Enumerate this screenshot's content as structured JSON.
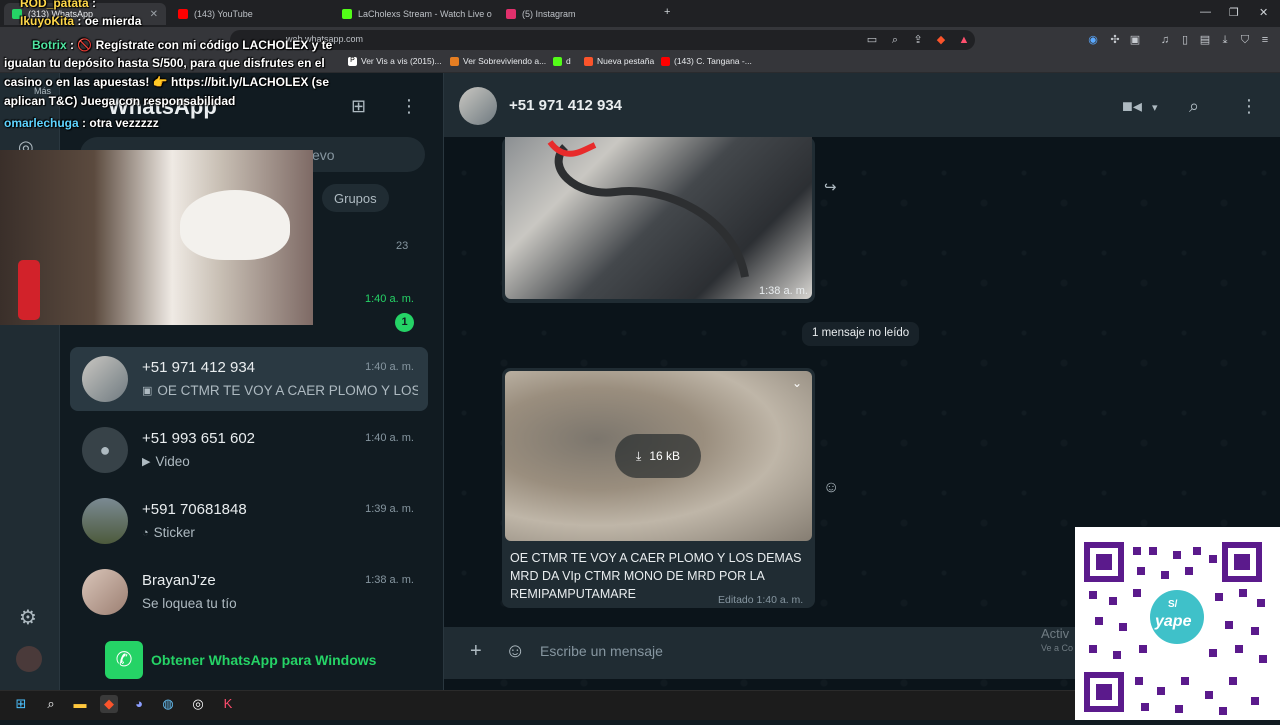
{
  "browser": {
    "tabs": [
      {
        "label": "(313) WhatsApp",
        "active": true,
        "color": "#25d366"
      },
      {
        "label": "(143) YouTube",
        "active": false,
        "color": "#ff0000"
      },
      {
        "label": "LaCholexs Stream - Watch Live o",
        "active": false,
        "color": "#53fc18"
      },
      {
        "label": "(5) Instagram",
        "active": false,
        "color": "#e1306c"
      }
    ],
    "url": "web.whatsapp.com",
    "bookmarks": [
      {
        "label": "Ver Vis a vis (2015)...",
        "icon": "P"
      },
      {
        "label": "Ver Sobreviviendo a...",
        "icon": "N"
      },
      {
        "label": "d",
        "icon": "K"
      },
      {
        "label": "Nueva pestaña",
        "icon": "B"
      },
      {
        "label": "(143) C. Tangana -...",
        "icon": "Y"
      }
    ]
  },
  "whatsapp": {
    "title": "WhatsApp",
    "search_placeholder": "evo",
    "filter_chip": "Groups",
    "filter_chip_text": "Grupos",
    "hidden_row_count": "23",
    "hidden_row_time": "1:40 a. m.",
    "hidden_row_badge": "1",
    "chats": [
      {
        "name": "+51 971 412 934",
        "time": "1:40 a. m.",
        "preview": "OE CTMR TE VOY A CAER PLOMO Y LOS ...",
        "preview_icon": "image-icon",
        "selected": true
      },
      {
        "name": "+51 993 651 602",
        "time": "1:40 a. m.",
        "preview": "Video",
        "preview_icon": "video-icon",
        "selected": false
      },
      {
        "name": "+591 70681848",
        "time": "1:39 a. m.",
        "preview": "Sticker",
        "preview_icon": "sticker-icon",
        "selected": false
      },
      {
        "name": "BrayanJ'ze",
        "time": "1:38 a. m.",
        "preview": "Se loquea tu tío",
        "preview_icon": "",
        "selected": false
      }
    ],
    "get_windows": "Obtener WhatsApp para Windows"
  },
  "conversation": {
    "contact": "+51 971 412 934",
    "image_time": "1:38 a. m.",
    "unread_label": "1 mensaje no leído",
    "download_size": "16 kB",
    "message_text": "OE CTMR TE VOY A CAER PLOMO Y LOS DEMAS MRD DA VIp CTMR MONO DE MRD POR LA REMIPAMPUTAMARE",
    "edited_label": "Editado 1:40 a. m.",
    "composer_placeholder": "Escribe un mensaje",
    "activate_windows": "Activ",
    "activate_windows2": "Ve a Co"
  },
  "overlay": {
    "chat": [
      {
        "user": "ROD_patata",
        "text": ":"
      },
      {
        "user": "IkuyoKita",
        "text": ": oe mierda"
      },
      {
        "user": "Botrix",
        "text": ": 🚫 Regístrate con mi código LACHOLEX y te"
      },
      {
        "user": "",
        "text": "igualan tu depósito hasta S/500, para que disfrutes en el"
      },
      {
        "user": "",
        "text": "casino o en las apuestas! 👉 https://bit.ly/LACHOLEX (se"
      },
      {
        "user": "",
        "text": "aplican T&C) Juega con responsabilidad"
      },
      {
        "user": "omarlechuga",
        "text": ": otra vezzzzz"
      }
    ],
    "mas_label": "Más",
    "qr_brand": "yape",
    "qr_badge": "S/"
  }
}
